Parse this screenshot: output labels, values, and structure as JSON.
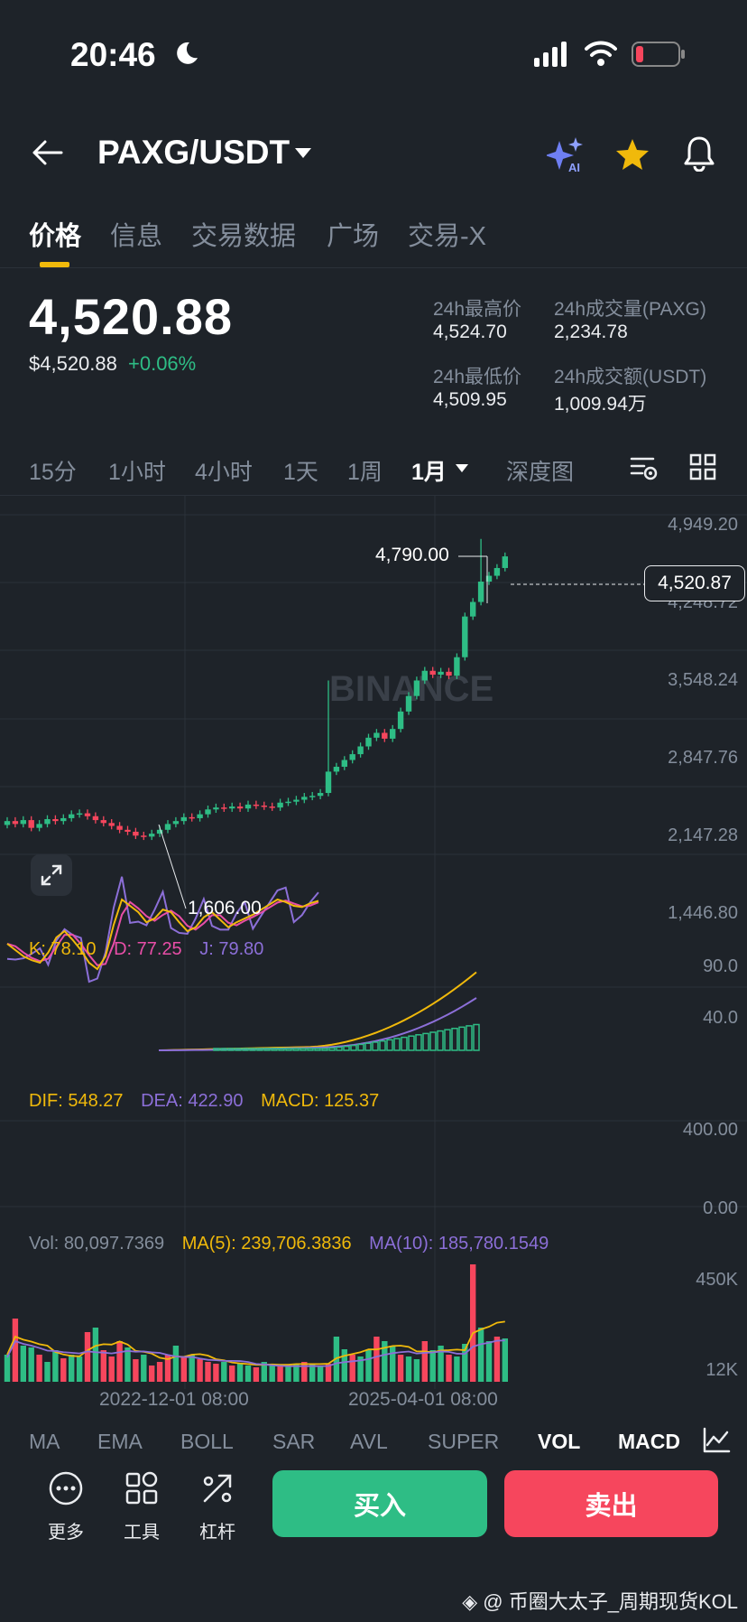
{
  "status_bar": {
    "time": "20:46"
  },
  "header": {
    "pair": "PAXG/USDT"
  },
  "tabs": [
    "价格",
    "信息",
    "交易数据",
    "广场",
    "交易-X"
  ],
  "price": {
    "last": "4,520.88",
    "usd": "$4,520.88",
    "change": "+0.06%",
    "high_label": "24h最高价",
    "high": "4,524.70",
    "low_label": "24h最低价",
    "low": "4,509.95",
    "vol_base_label": "24h成交量(PAXG)",
    "vol_base": "2,234.78",
    "vol_quote_label": "24h成交额(USDT)",
    "vol_quote": "1,009.94万"
  },
  "intervals": [
    "15分",
    "1小时",
    "4小时",
    "1天",
    "1周",
    "1月",
    "深度图"
  ],
  "active_interval": "1月",
  "chart": {
    "y_ticks": [
      "4,949.20",
      "4,248.72",
      "3,548.24",
      "2,847.76",
      "2,147.28",
      "1,446.80"
    ],
    "current_price_tag": "4,520.87",
    "high_marker": "4,790.00",
    "low_marker": "1,606.00",
    "watermark": "BINANCE",
    "kdj": {
      "k": "K: 78.10",
      "d": "D: 77.25",
      "j": "J: 79.80",
      "ticks": [
        "90.0",
        "40.0"
      ]
    },
    "macd": {
      "dif": "DIF: 548.27",
      "dea": "DEA: 422.90",
      "macd": "MACD: 125.37",
      "ticks": [
        "400.00",
        "0.00"
      ]
    },
    "vol": {
      "vol": "Vol: 80,097.7369",
      "ma5": "MA(5): 239,706.3836",
      "ma10": "MA(10): 185,780.1549",
      "ticks": [
        "450K",
        "12K"
      ]
    },
    "x_labels": [
      "2022-12-01 08:00",
      "2025-04-01 08:00"
    ],
    "colors": {
      "up": "#2ebd85",
      "down": "#f6465d",
      "k": "#f0b90b",
      "d": "#e84ea7",
      "j": "#8c6fd8"
    }
  },
  "indicator_tabs": [
    "MA",
    "EMA",
    "BOLL",
    "SAR",
    "AVL",
    "SUPER",
    "VOL",
    "MACD"
  ],
  "indicator_active": [
    "VOL",
    "MACD"
  ],
  "tools": [
    {
      "icon": "more-icon",
      "label": "更多"
    },
    {
      "icon": "tools-icon",
      "label": "工具"
    },
    {
      "icon": "leverage-icon",
      "label": "杠杆"
    }
  ],
  "actions": {
    "buy": "买入",
    "sell": "卖出"
  },
  "footer_watermark": "@ 币圈大太子_周期现货KOL"
}
